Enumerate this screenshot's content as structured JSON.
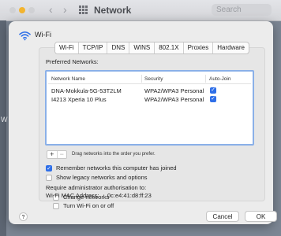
{
  "background": {
    "title": "Network",
    "search_placeholder": "Search",
    "side_letter": "W"
  },
  "sheet": {
    "title": "Wi-Fi",
    "tabs": [
      "Wi-Fi",
      "TCP/IP",
      "DNS",
      "WINS",
      "802.1X",
      "Proxies",
      "Hardware"
    ],
    "selected_tab": "Wi-Fi",
    "preferred_label": "Preferred Networks:",
    "table": {
      "headers": {
        "name": "Network Name",
        "security": "Security",
        "auto_join": "Auto-Join"
      },
      "rows": [
        {
          "name": "DNA-Mokkula-5G-53T2LM",
          "security": "WPA2/WPA3 Personal",
          "auto_join": true
        },
        {
          "name": "I4213 Xperia 10 Plus",
          "security": "WPA2/WPA3 Personal",
          "auto_join": true
        }
      ]
    },
    "add_symbol": "+",
    "remove_symbol": "−",
    "drag_note": "Drag networks into the order you prefer.",
    "options": {
      "remember": {
        "label": "Remember networks this computer has joined",
        "checked": true
      },
      "legacy": {
        "label": "Show legacy networks and options",
        "checked": false
      }
    },
    "admin_label": "Require administrator authorisation to:",
    "admin_options": {
      "change_networks": {
        "label": "Change networks",
        "checked": false
      },
      "turn_wifi": {
        "label": "Turn Wi-Fi on or off",
        "checked": false
      }
    },
    "mac": {
      "label": "Wi-Fi MAC Address:",
      "value": "0c:e4:41:d8:ff:23"
    },
    "help_symbol": "?",
    "cancel_label": "Cancel",
    "ok_label": "OK"
  },
  "colors": {
    "accent": "#2f6fe8",
    "focus_ring": "#8ab0e8"
  },
  "icons": {
    "sheet": "wifi-icon",
    "checkbox": "checkmark-icon",
    "nav": "chevron-icon"
  }
}
